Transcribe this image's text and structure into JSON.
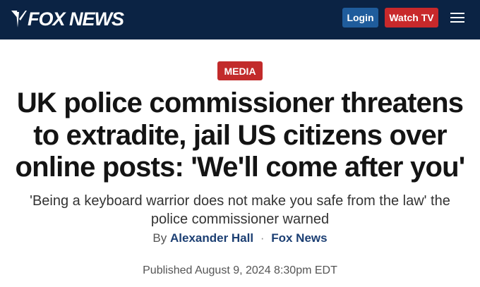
{
  "header": {
    "logo_text": "FOX NEWS",
    "login_label": "Login",
    "watch_label": "Watch TV",
    "colors": {
      "bar": "#0b2344",
      "login": "#1f5c9c",
      "watch": "#c8292b"
    }
  },
  "article": {
    "category": "MEDIA",
    "headline": "UK police commissioner threatens to extradite, jail US citizens over online posts: 'We'll come after you'",
    "subheadline": "'Being a keyboard warrior does not make you safe from the law' the police commissioner warned",
    "byline_prefix": "By",
    "author": "Alexander Hall",
    "separator": "·",
    "source": "Fox News",
    "published": "Published August 9, 2024 8:30pm EDT"
  }
}
